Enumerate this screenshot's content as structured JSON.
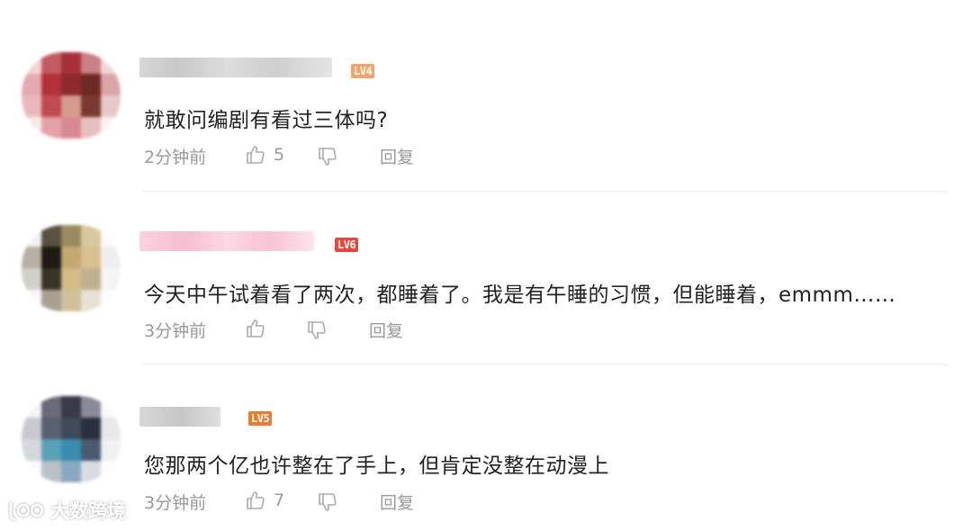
{
  "comments": [
    {
      "level": "LV4",
      "level_color": "#f2a46a",
      "text": "就敢问编剧有看过三体吗?",
      "time": "2分钟前",
      "likes": "5",
      "reply": "回复"
    },
    {
      "level": "LV6",
      "level_color": "#e8453c",
      "text": "今天中午试着看了两次，都睡着了。我是有午睡的习惯，但能睡着，emmm……",
      "time": "3分钟前",
      "likes": "",
      "reply": "回复"
    },
    {
      "level": "LV5",
      "level_color": "#ef7a2c",
      "text": "您那两个亿也许整在了手上，但肯定没整在动漫上",
      "time": "3分钟前",
      "likes": "7",
      "reply": "回复"
    }
  ],
  "icons": {
    "like": "thumbs-up-icon",
    "dislike": "thumbs-down-icon"
  },
  "watermark": {
    "text": "大数跨境"
  }
}
